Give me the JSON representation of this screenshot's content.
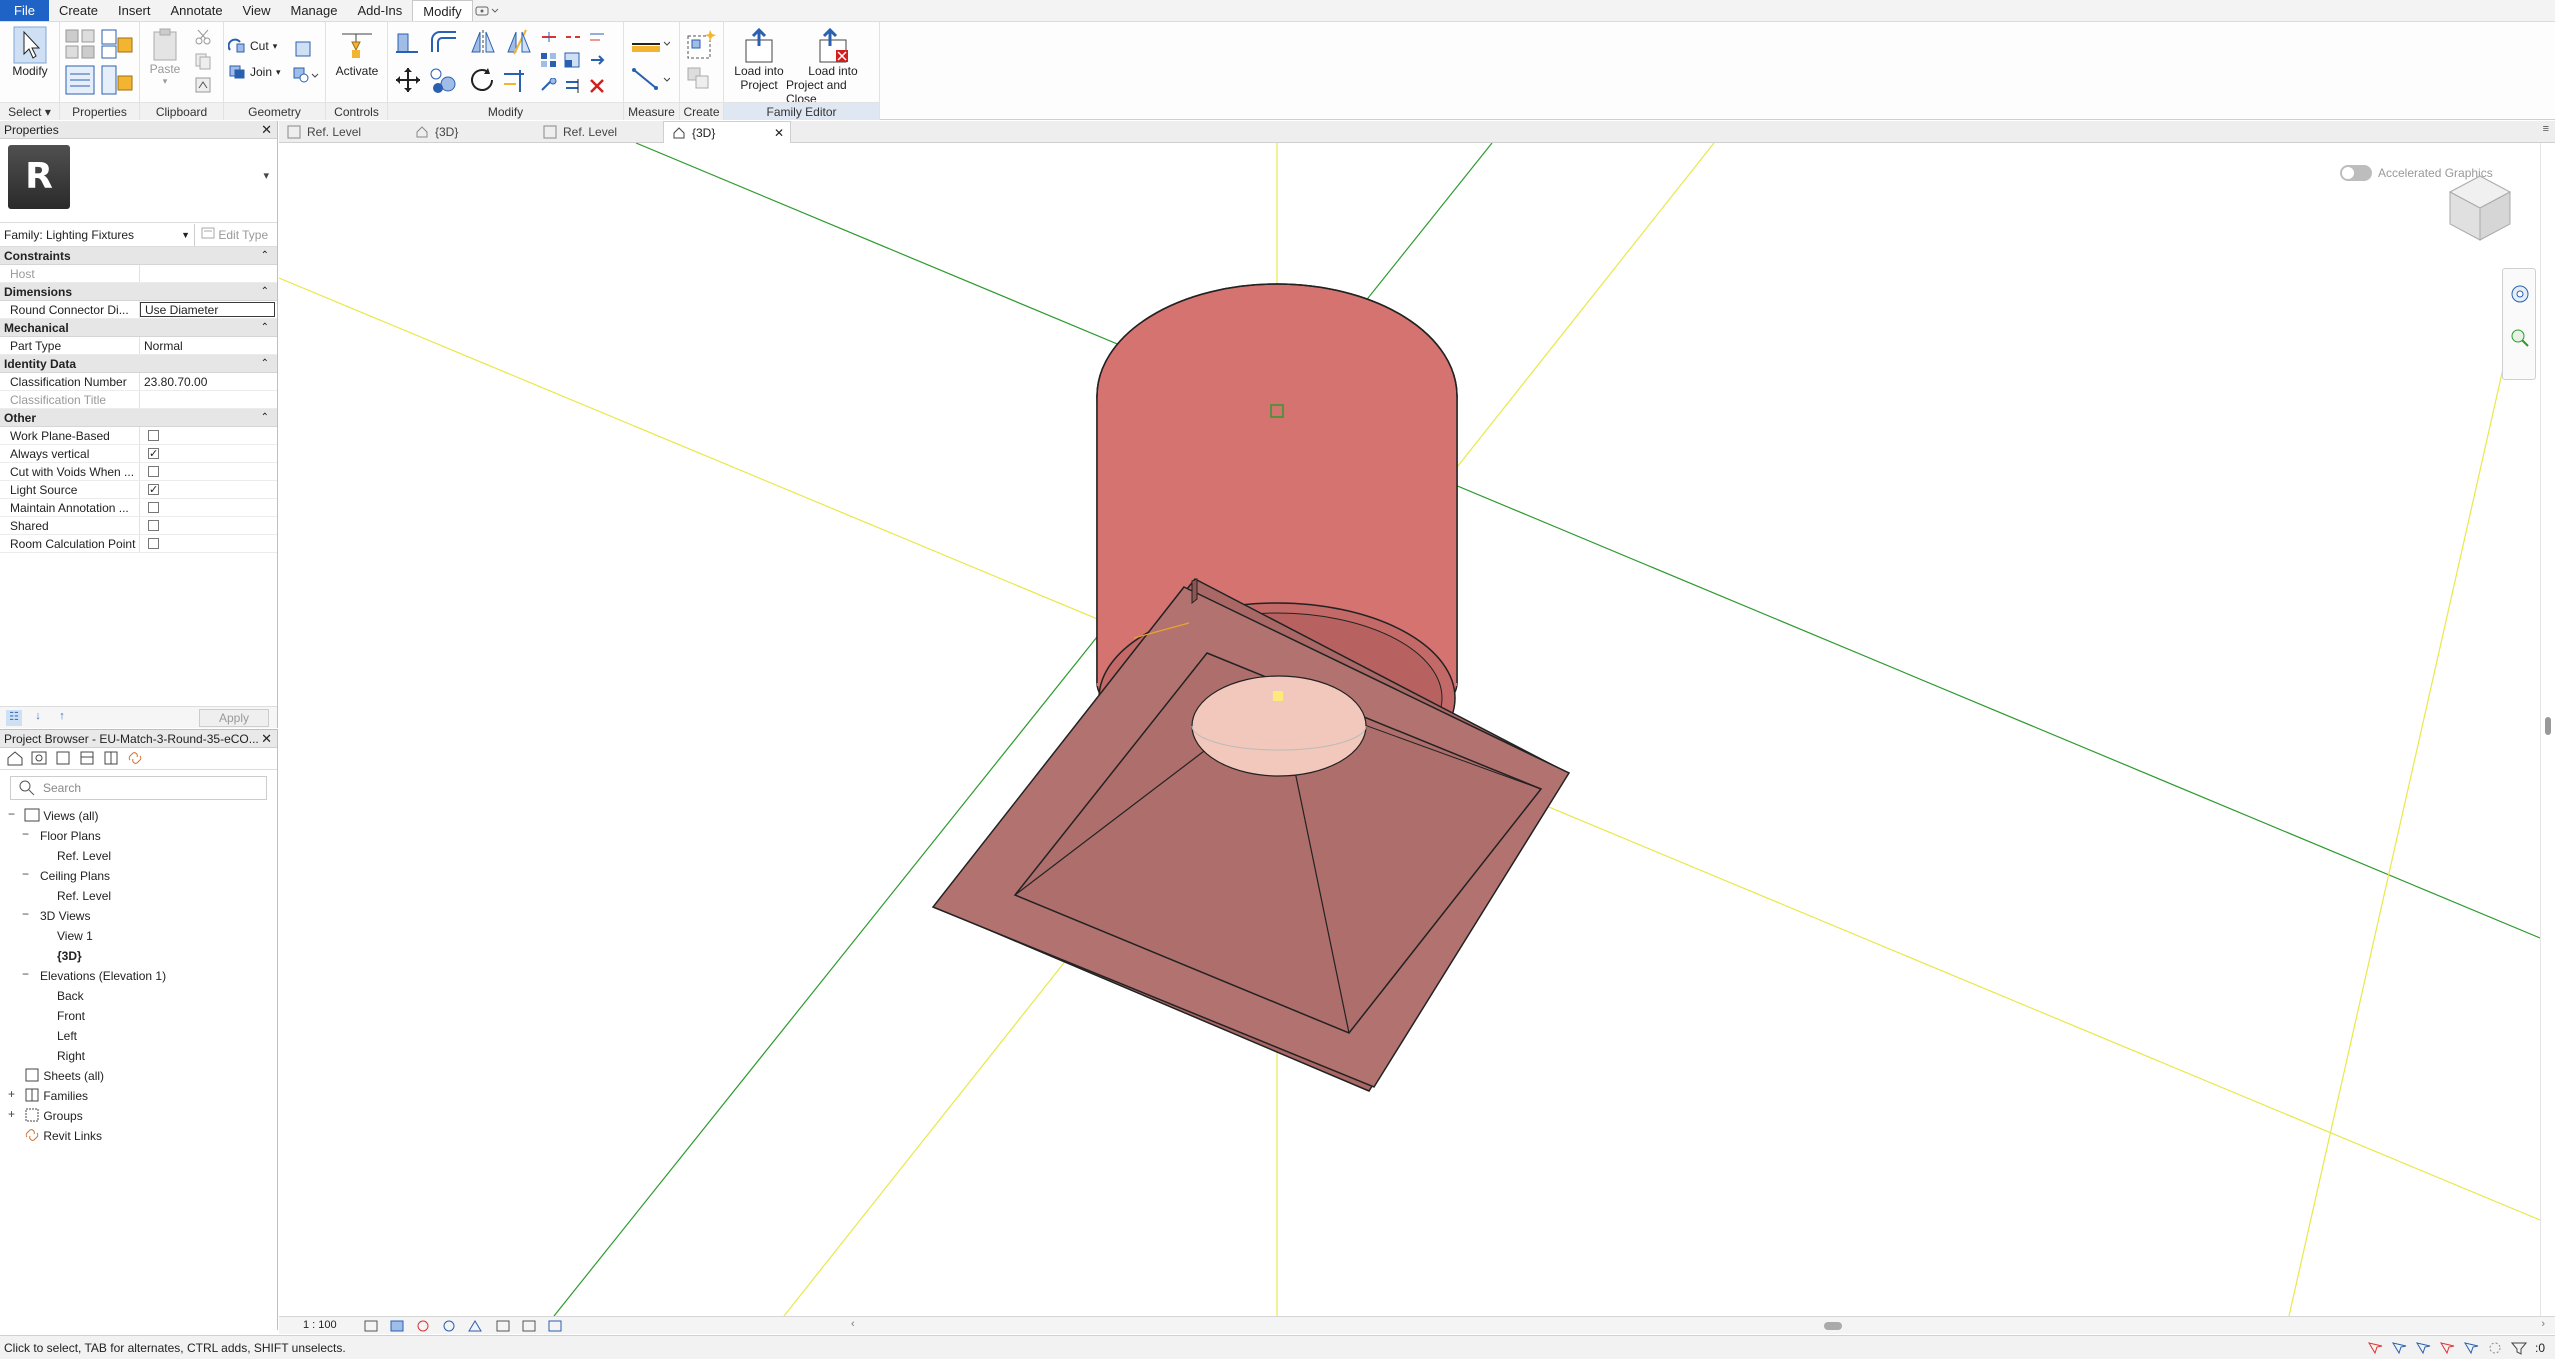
{
  "menu": {
    "tabs": [
      "File",
      "Create",
      "Insert",
      "Annotate",
      "View",
      "Manage",
      "Add-Ins",
      "Modify"
    ],
    "active_tab": "Modify"
  },
  "ribbon": {
    "panels": {
      "select": "Select",
      "properties": "Properties",
      "clipboard": "Clipboard",
      "geometry": "Geometry",
      "controls": "Controls",
      "modify": "Modify",
      "measure": "Measure",
      "create": "Create",
      "family_editor": "Family Editor"
    },
    "buttons": {
      "modify": "Modify",
      "paste": "Paste",
      "cut": "Cut",
      "join": "Join",
      "activate": "Activate",
      "load_into_project_line1": "Load into",
      "load_into_project_line2": "Project",
      "load_close_line1": "Load into",
      "load_close_line2": "Project and Close"
    }
  },
  "properties": {
    "title": "Properties",
    "family": "Family: Lighting Fixtures",
    "edit_type": "Edit Type",
    "groups": {
      "constraints": "Constraints",
      "dimensions": "Dimensions",
      "mechanical": "Mechanical",
      "identity": "Identity Data",
      "other": "Other"
    },
    "rows": {
      "host": {
        "k": "Host",
        "v": ""
      },
      "round_connector": {
        "k": "Round Connector Di...",
        "v": "Use Diameter"
      },
      "part_type": {
        "k": "Part Type",
        "v": "Normal"
      },
      "class_number": {
        "k": "Classification Number",
        "v": "23.80.70.00"
      },
      "class_title": {
        "k": "Classification Title",
        "v": ""
      },
      "work_plane": {
        "k": "Work Plane-Based"
      },
      "always_vertical": {
        "k": "Always vertical"
      },
      "cut_voids": {
        "k": "Cut with Voids When ..."
      },
      "light_source": {
        "k": "Light Source"
      },
      "maintain_annotation": {
        "k": "Maintain Annotation ..."
      },
      "shared": {
        "k": "Shared"
      },
      "room_calc": {
        "k": "Room Calculation Point"
      }
    },
    "apply": "Apply"
  },
  "browser": {
    "title": "Project Browser - EU-Match-3-Round-35-eCO...",
    "search_placeholder": "Search",
    "nodes": {
      "views_all": "Views (all)",
      "floor_plans": "Floor Plans",
      "fp_ref": "Ref. Level",
      "ceiling_plans": "Ceiling Plans",
      "cp_ref": "Ref. Level",
      "views3d": "3D Views",
      "view1": "View 1",
      "v3d": "{3D}",
      "elevations": "Elevations (Elevation 1)",
      "back": "Back",
      "front": "Front",
      "left": "Left",
      "right": "Right",
      "sheets": "Sheets (all)",
      "families": "Families",
      "groups": "Groups",
      "revit_links": "Revit Links"
    }
  },
  "view_tabs": [
    "Ref. Level",
    "{3D}",
    "Ref. Level",
    "{3D}"
  ],
  "viewport": {
    "accelerated_graphics": "Accelerated Graphics",
    "scale": "1 : 100"
  },
  "status": {
    "hint": "Click to select, TAB for alternates, CTRL adds, SHIFT unselects.",
    "filter_count": ":0"
  },
  "colors": {
    "accent": "#1f63c6",
    "body_red": "#d47370",
    "plate": "#b27270",
    "lens": "#f1c8bb",
    "axis_green": "#2e9a2e",
    "axis_yellow": "#e8e84a"
  }
}
